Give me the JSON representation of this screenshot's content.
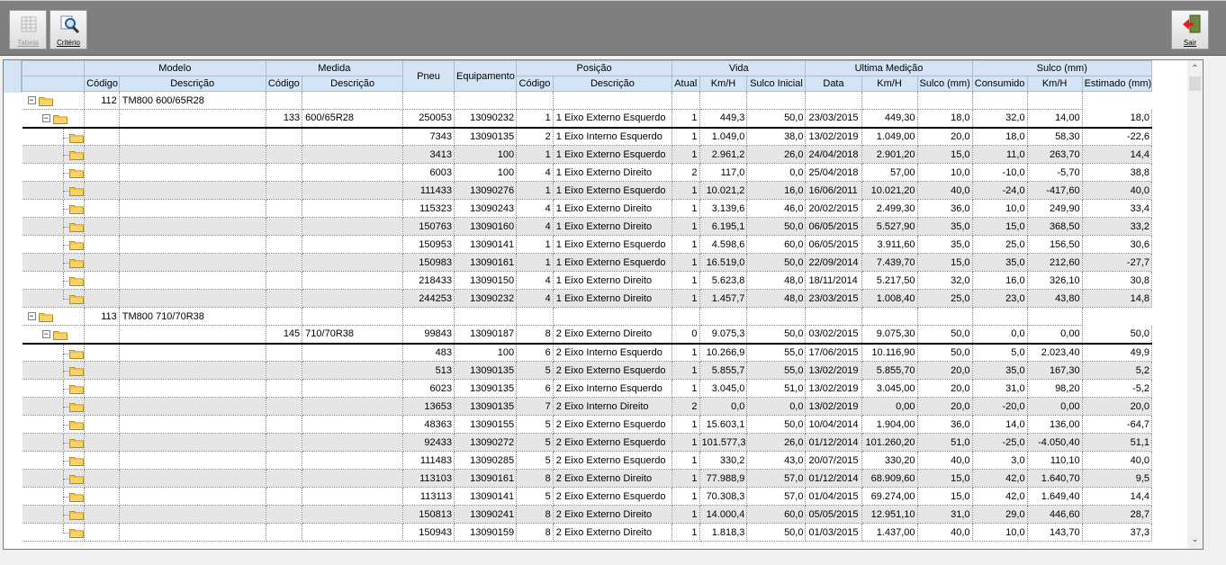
{
  "toolbar": {
    "tabela_label": "Tabela",
    "criterio_label": "Critério",
    "sair_label": "Sair"
  },
  "headers": {
    "modelo": "Modelo",
    "medida": "Medida",
    "posicao": "Posição",
    "vida": "Vida",
    "ultima": "Ultima Medição",
    "sulco": "Sulco (mm)",
    "codigo": "Código",
    "descricao": "Descrição",
    "pneu": "Pneu",
    "equipamento": "Equipamento",
    "atual": "Atual",
    "kmh": "Km/H",
    "sulco_inicial": "Sulco Inicial",
    "data": "Data",
    "sulco_mm": "Sulco (mm)",
    "consumido": "Consumido",
    "estimado": "Estimado (mm)"
  },
  "groups": [
    {
      "modelo_codigo": "112",
      "modelo_desc": "TM800 600/65R28",
      "medida_codigo": "133",
      "medida_desc": "600/65R28",
      "rows": [
        [
          "250053",
          "13090232",
          "1",
          "1 Eixo Externo Esquerdo",
          "1",
          "449,3",
          "50,0",
          "23/03/2015",
          "449,30",
          "18,0",
          "32,0",
          "14,00",
          "18,0"
        ],
        [
          "7343",
          "13090135",
          "2",
          "1 Eixo Interno Esquerdo",
          "1",
          "1.049,0",
          "38,0",
          "13/02/2019",
          "1.049,00",
          "20,0",
          "18,0",
          "58,30",
          "-22,6"
        ],
        [
          "3413",
          "100",
          "1",
          "1 Eixo Externo Esquerdo",
          "1",
          "2.961,2",
          "26,0",
          "24/04/2018",
          "2.901,20",
          "15,0",
          "11,0",
          "263,70",
          "14,4"
        ],
        [
          "6003",
          "100",
          "4",
          "1 Eixo Externo Direito",
          "2",
          "117,0",
          "0,0",
          "25/04/2018",
          "57,00",
          "10,0",
          "-10,0",
          "-5,70",
          "38,8"
        ],
        [
          "111433",
          "13090276",
          "1",
          "1 Eixo Externo Esquerdo",
          "1",
          "10.021,2",
          "16,0",
          "16/06/2011",
          "10.021,20",
          "40,0",
          "-24,0",
          "-417,60",
          "40,0"
        ],
        [
          "115323",
          "13090243",
          "4",
          "1 Eixo Externo Direito",
          "1",
          "3.139,6",
          "46,0",
          "20/02/2015",
          "2.499,30",
          "36,0",
          "10,0",
          "249,90",
          "33,4"
        ],
        [
          "150763",
          "13090160",
          "4",
          "1 Eixo Externo Direito",
          "1",
          "6.195,1",
          "50,0",
          "06/05/2015",
          "5.527,90",
          "35,0",
          "15,0",
          "368,50",
          "33,2"
        ],
        [
          "150953",
          "13090141",
          "1",
          "1 Eixo Externo Esquerdo",
          "1",
          "4.598,6",
          "60,0",
          "06/05/2015",
          "3.911,60",
          "35,0",
          "25,0",
          "156,50",
          "30,6"
        ],
        [
          "150983",
          "13090161",
          "1",
          "1 Eixo Externo Esquerdo",
          "1",
          "16.519,0",
          "50,0",
          "22/09/2014",
          "7.439,70",
          "15,0",
          "35,0",
          "212,60",
          "-27,7"
        ],
        [
          "218433",
          "13090150",
          "4",
          "1 Eixo Externo Direito",
          "1",
          "5.623,8",
          "48,0",
          "18/11/2014",
          "5.217,50",
          "32,0",
          "16,0",
          "326,10",
          "30,8"
        ],
        [
          "244253",
          "13090232",
          "4",
          "1 Eixo Externo Direito",
          "1",
          "1.457,7",
          "48,0",
          "23/03/2015",
          "1.008,40",
          "25,0",
          "23,0",
          "43,80",
          "14,8"
        ]
      ]
    },
    {
      "modelo_codigo": "113",
      "modelo_desc": "TM800 710/70R38",
      "medida_codigo": "145",
      "medida_desc": "710/70R38",
      "rows": [
        [
          "99843",
          "13090187",
          "8",
          "2 Eixo Externo Direito",
          "0",
          "9.075,3",
          "50,0",
          "03/02/2015",
          "9.075,30",
          "50,0",
          "0,0",
          "0,00",
          "50,0"
        ],
        [
          "483",
          "100",
          "6",
          "2 Eixo Interno Esquerdo",
          "1",
          "10.266,9",
          "55,0",
          "17/06/2015",
          "10.116,90",
          "50,0",
          "5,0",
          "2.023,40",
          "49,9"
        ],
        [
          "513",
          "13090135",
          "5",
          "2 Eixo Externo Esquerdo",
          "1",
          "5.855,7",
          "55,0",
          "13/02/2019",
          "5.855,70",
          "20,0",
          "35,0",
          "167,30",
          "5,2"
        ],
        [
          "6023",
          "13090135",
          "6",
          "2 Eixo Interno Esquerdo",
          "1",
          "3.045,0",
          "51,0",
          "13/02/2019",
          "3.045,00",
          "20,0",
          "31,0",
          "98,20",
          "-5,2"
        ],
        [
          "13653",
          "13090135",
          "7",
          "2 Eixo Interno Direito",
          "2",
          "0,0",
          "0,0",
          "13/02/2019",
          "0,00",
          "20,0",
          "-20,0",
          "0,00",
          "20,0"
        ],
        [
          "48363",
          "13090155",
          "5",
          "2 Eixo Externo Esquerdo",
          "1",
          "15.603,1",
          "50,0",
          "10/04/2014",
          "1.904,00",
          "36,0",
          "14,0",
          "136,00",
          "-64,7"
        ],
        [
          "92433",
          "13090272",
          "5",
          "2 Eixo Externo Esquerdo",
          "1",
          "101.577,3",
          "26,0",
          "01/12/2014",
          "101.260,20",
          "51,0",
          "-25,0",
          "-4.050,40",
          "51,1"
        ],
        [
          "111483",
          "13090285",
          "5",
          "2 Eixo Externo Esquerdo",
          "1",
          "330,2",
          "43,0",
          "20/07/2015",
          "330,20",
          "40,0",
          "3,0",
          "110,10",
          "40,0"
        ],
        [
          "113103",
          "13090161",
          "8",
          "2 Eixo Externo Direito",
          "1",
          "77.988,9",
          "57,0",
          "01/12/2014",
          "68.909,60",
          "15,0",
          "42,0",
          "1.640,70",
          "9,5"
        ],
        [
          "113113",
          "13090141",
          "5",
          "2 Eixo Externo Esquerdo",
          "1",
          "70.308,3",
          "57,0",
          "01/04/2015",
          "69.274,00",
          "15,0",
          "42,0",
          "1.649,40",
          "14,4"
        ],
        [
          "150813",
          "13090241",
          "8",
          "2 Eixo Externo Direito",
          "1",
          "14.000,4",
          "60,0",
          "05/05/2015",
          "12.951,10",
          "31,0",
          "29,0",
          "446,60",
          "28,7"
        ],
        [
          "150943",
          "13090159",
          "8",
          "2 Eixo Externo Direito",
          "1",
          "1.818,3",
          "50,0",
          "01/03/2015",
          "1.437,00",
          "40,0",
          "10,0",
          "143,70",
          "37,3"
        ]
      ]
    }
  ]
}
